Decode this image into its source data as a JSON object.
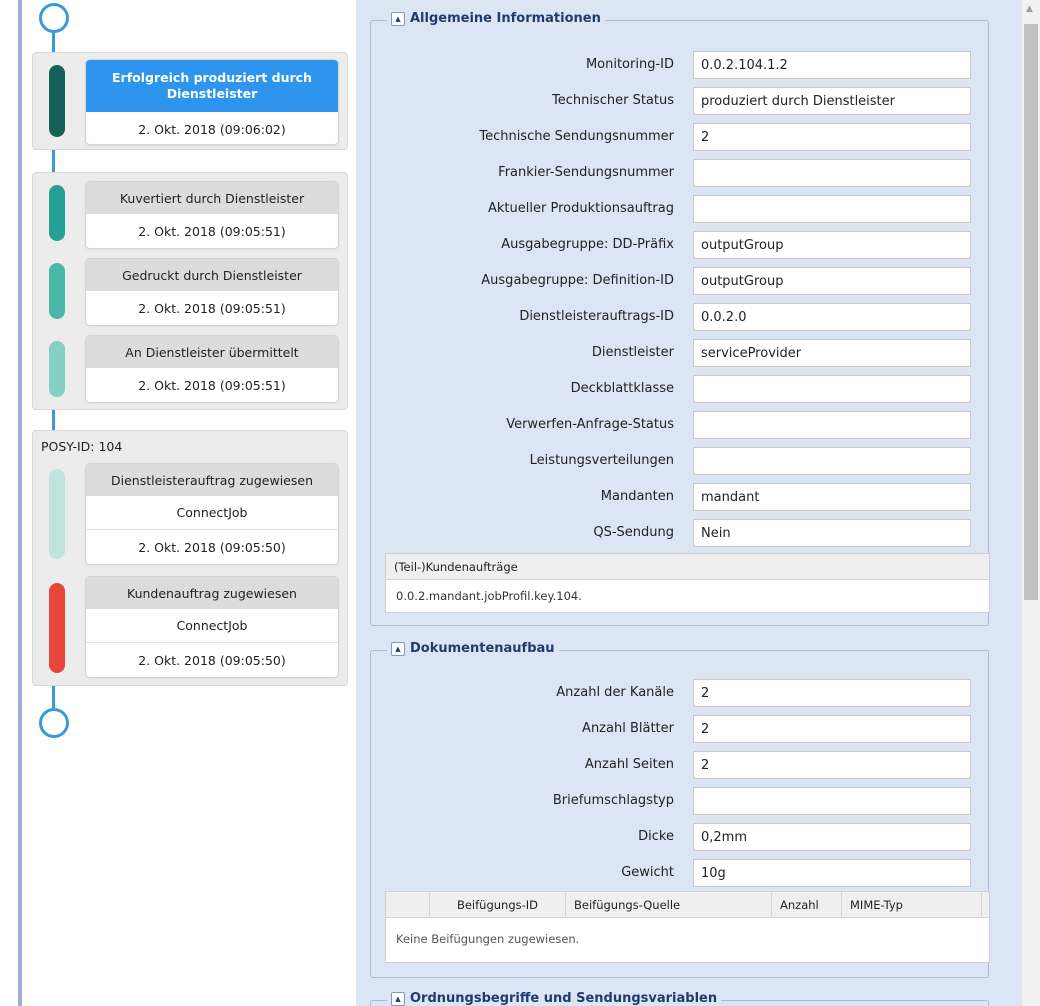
{
  "timeline": {
    "groups": [
      {
        "events": [
          {
            "title": "Erfolgreich produziert durch Dienstleister",
            "date": "2. Okt. 2018 (09:06:02)",
            "color": "#15615a",
            "active": true
          }
        ]
      },
      {
        "events": [
          {
            "title": "Kuvertiert durch Dienstleister",
            "date": "2. Okt. 2018 (09:05:51)",
            "color": "#26a096"
          },
          {
            "title": "Gedruckt durch Dienstleister",
            "date": "2. Okt. 2018 (09:05:51)",
            "color": "#4ab8a8"
          },
          {
            "title": "An Dienstleister übermittelt",
            "date": "2. Okt. 2018 (09:05:51)",
            "color": "#86cfc6"
          }
        ]
      },
      {
        "posy_label": "POSY-ID: 104",
        "events": [
          {
            "title": "Dienstleisterauftrag zugewiesen",
            "sub": "ConnectJob",
            "date": "2. Okt. 2018 (09:05:50)",
            "color": "#bfe3df"
          },
          {
            "title": "Kundenauftrag zugewiesen",
            "sub": "ConnectJob",
            "date": "2. Okt. 2018 (09:05:50)",
            "color": "#e8463a"
          }
        ]
      }
    ]
  },
  "sections": {
    "allgemein": {
      "title": "Allgemeine Informationen",
      "fields": [
        {
          "label": "Monitoring-ID",
          "value": "0.0.2.104.1.2"
        },
        {
          "label": "Technischer Status",
          "value": "produziert durch Dienstleister"
        },
        {
          "label": "Technische Sendungsnummer",
          "value": "2"
        },
        {
          "label": "Frankier-Sendungsnummer",
          "value": ""
        },
        {
          "label": "Aktueller Produktionsauftrag",
          "value": ""
        },
        {
          "label": "Ausgabegruppe: DD-Präfix",
          "value": "outputGroup"
        },
        {
          "label": "Ausgabegruppe: Definition-ID",
          "value": "outputGroup"
        },
        {
          "label": "Dienstleisterauftrags-ID",
          "value": "0.0.2.0"
        },
        {
          "label": "Dienstleister",
          "value": "serviceProvider"
        },
        {
          "label": "Deckblattklasse",
          "value": ""
        },
        {
          "label": "Verwerfen-Anfrage-Status",
          "value": ""
        },
        {
          "label": "Leistungsverteilungen",
          "value": ""
        },
        {
          "label": "Mandanten",
          "value": "mandant"
        },
        {
          "label": "QS-Sendung",
          "value": "Nein"
        }
      ],
      "table": {
        "header": "(Teil-)Kundenaufträge",
        "rows": [
          "0.0.2.mandant.jobProfil.key.104."
        ]
      }
    },
    "dokument": {
      "title": "Dokumentenaufbau",
      "fields": [
        {
          "label": "Anzahl der Kanäle",
          "value": "2"
        },
        {
          "label": "Anzahl Blätter",
          "value": "2"
        },
        {
          "label": "Anzahl Seiten",
          "value": "2"
        },
        {
          "label": "Briefumschlagstyp",
          "value": ""
        },
        {
          "label": "Dicke",
          "value": "0,2mm"
        },
        {
          "label": "Gewicht",
          "value": "10g"
        }
      ],
      "table": {
        "columns": [
          "Beifügungs-ID",
          "Beifügungs-Quelle",
          "Anzahl",
          "MIME-Typ"
        ],
        "empty_text": "Keine Beifügungen zugewiesen."
      }
    },
    "ordnung": {
      "title": "Ordnungsbegriffe und Sendungsvariablen"
    }
  }
}
